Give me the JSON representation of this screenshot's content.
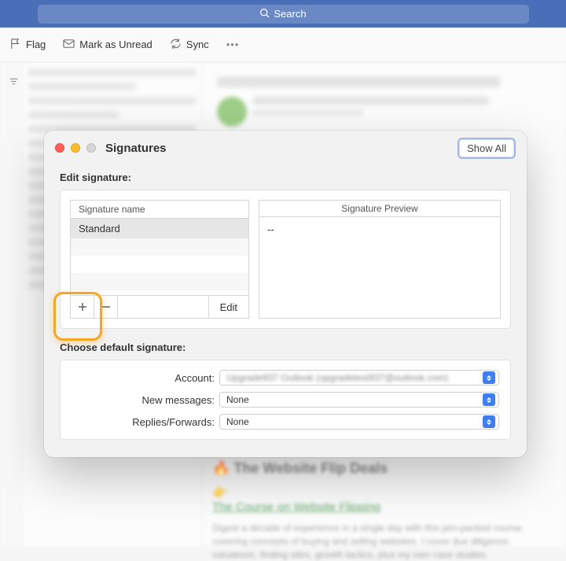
{
  "search": {
    "placeholder": "Search"
  },
  "toolbar": {
    "flag": "Flag",
    "mark_unread": "Mark as Unread",
    "sync": "Sync",
    "more": "•••"
  },
  "modal": {
    "title": "Signatures",
    "show_all": "Show All",
    "edit_label": "Edit signature:",
    "sig_header": "Signature name",
    "signatures": [
      "Standard"
    ],
    "edit_btn": "Edit",
    "preview_header": "Signature Preview",
    "preview_body": "--",
    "choose_label": "Choose default signature:",
    "account_label": "Account:",
    "new_msg_label": "New messages:",
    "replies_label": "Replies/Forwards:",
    "account_value": "Upgrade937 Outlook (upgradetest937@outlook.com)",
    "new_msg_value": "None",
    "replies_value": "None"
  },
  "bg": {
    "heading": "🔥 The Website Flip Deals",
    "link": "The Course on Website Flipping",
    "para": "Digest a decade of experience in a single day with this jam-packed course covering concepts of buying and selling websites. I cover due diligence, valuations, finding sites, growth tactics, plus my own case studies."
  }
}
